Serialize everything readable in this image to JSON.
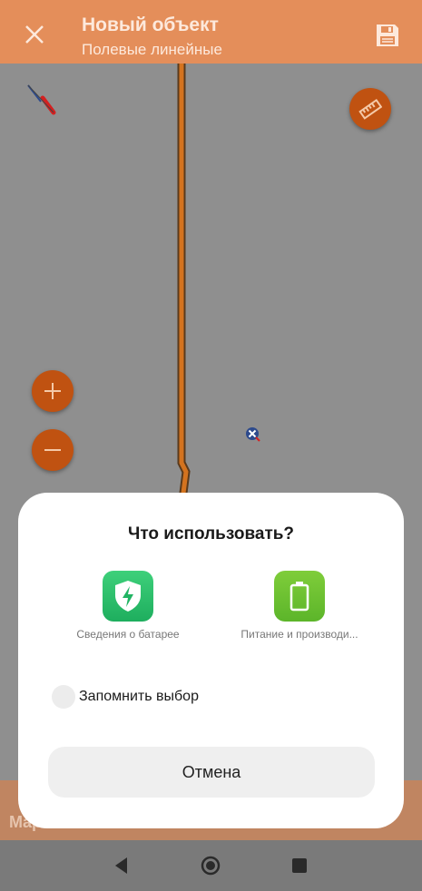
{
  "appbar": {
    "title": "Новый объект",
    "subtitle": "Полевые линейные",
    "close_icon": "close-icon",
    "save_icon": "save-icon"
  },
  "map": {
    "zoom_in_icon": "plus-icon",
    "zoom_out_icon": "minus-icon",
    "ruler_icon": "ruler-icon",
    "compass_icon": "compass-icon",
    "logo": "Maps.me"
  },
  "dialog": {
    "title": "Что использовать?",
    "options": [
      {
        "label": "Сведения о батарее",
        "icon": "battery-shield-icon",
        "color": "#2fc06d"
      },
      {
        "label": "Питание и производи...",
        "icon": "battery-icon",
        "color": "#6cc132"
      }
    ],
    "remember_label": "Запомнить выбор",
    "cancel_label": "Отмена"
  },
  "navbar": {
    "back_icon": "back-icon",
    "home_icon": "home-icon",
    "recents_icon": "recents-icon"
  },
  "colors": {
    "accent": "#c05211",
    "scrim_map": "#8f8f8f",
    "dialog_bg": "#ffffff"
  }
}
